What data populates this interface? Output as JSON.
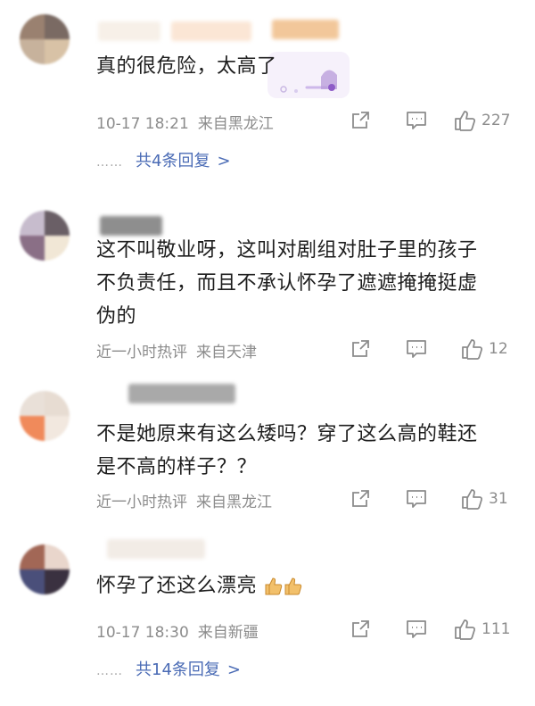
{
  "comments": [
    {
      "text_lines": [
        "真的很危险，太高了"
      ],
      "time": "10-17 18:21",
      "location": "来自黑龙江",
      "likes": "227",
      "replies": "共4条回复"
    },
    {
      "text_lines": [
        "这不叫敬业呀，这叫对剧组对肚子里的孩子",
        "不负责任，而且不承认怀孕了遮遮掩掩挺虚",
        "伪的"
      ],
      "time": "近一小时热评",
      "location": "来自天津",
      "likes": "12"
    },
    {
      "text_lines": [
        "不是她原来有这么矮吗？穿了这么高的鞋还",
        "是不高的样子？？"
      ],
      "time": "近一小时热评",
      "location": "来自黑龙江",
      "likes": "31"
    },
    {
      "text_lines": [
        "怀孕了还这么漂亮"
      ],
      "time": "10-17 18:30",
      "location": "来自新疆",
      "likes": "111",
      "replies": "共14条回复"
    }
  ],
  "icons": {
    "share": "share-icon",
    "comment": "comment-icon",
    "like": "thumbs-up-icon",
    "chevron": "chevron-right-icon",
    "thumbs_emoji": "thumbs-up-emoji"
  },
  "colors": {
    "reply_link": "#4a6bb5",
    "meta": "#8c8c8c"
  },
  "glyphs": {
    "chevron": ">",
    "dots": "……"
  }
}
